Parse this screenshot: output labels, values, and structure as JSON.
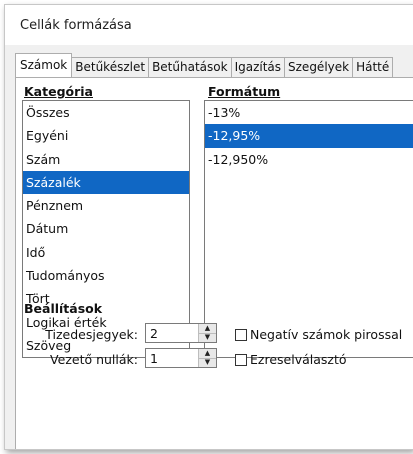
{
  "dialog": {
    "title": "Cellák formázása"
  },
  "tabs": [
    {
      "label": "Számok",
      "active": true
    },
    {
      "label": "Betűkészlet",
      "active": false
    },
    {
      "label": "Betűhatások",
      "active": false
    },
    {
      "label": "Igazítás",
      "active": false
    },
    {
      "label": "Szegélyek",
      "active": false
    },
    {
      "label": "Hátté",
      "active": false
    }
  ],
  "category": {
    "label": "Kategória",
    "items": [
      "Összes",
      "Egyéni",
      "Szám",
      "Százalék",
      "Pénznem",
      "Dátum",
      "Idő",
      "Tudományos",
      "Tört",
      "Logikai érték",
      "Szöveg"
    ],
    "selected_index": 3
  },
  "format": {
    "label": "Formátum",
    "items": [
      "-13%",
      "-12,95%",
      "-12,950%"
    ],
    "selected_index": 1
  },
  "options": {
    "title": "Beállítások",
    "decimal_places_label": "Tizedesjegyek:",
    "decimal_places_value": "2",
    "leading_zeros_label": "Vezető nullák:",
    "leading_zeros_value": "1",
    "negative_red_label": "Negatív számok pirossal",
    "thousands_separator_label": "Ezreselválasztó"
  },
  "colors": {
    "selection": "#1067c4"
  }
}
